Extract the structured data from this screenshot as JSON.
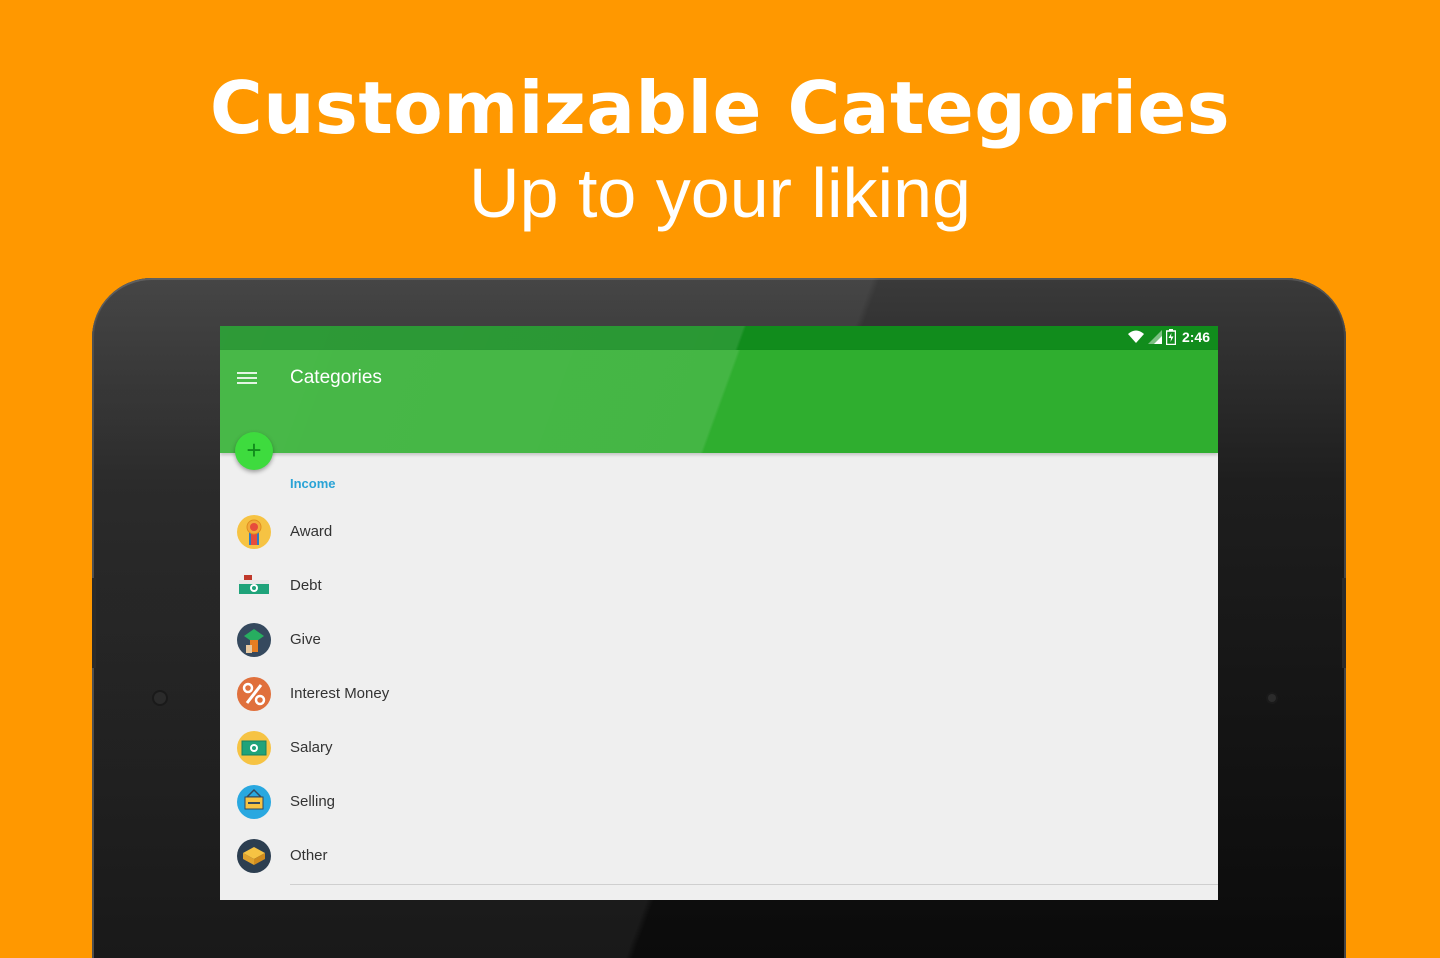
{
  "promo": {
    "headline": "Customizable Categories",
    "subline": "Up to your liking"
  },
  "colors": {
    "background": "#FF9800",
    "statusbar": "#118C1C",
    "appbar": "#2FAE2F",
    "fab": "#3EDB3E",
    "section_header": "#29A3D6"
  },
  "statusbar": {
    "time": "2:46",
    "icons": [
      "wifi-icon",
      "signal-icon",
      "battery-icon"
    ]
  },
  "appbar": {
    "title": "Categories",
    "menu_icon": "hamburger-menu-icon"
  },
  "fab": {
    "label": "+",
    "icon": "add-icon"
  },
  "section": {
    "header": "Income"
  },
  "categories": [
    {
      "label": "Award",
      "icon": "award-medal-icon"
    },
    {
      "label": "Debt",
      "icon": "money-drawer-icon"
    },
    {
      "label": "Give",
      "icon": "gift-give-icon"
    },
    {
      "label": "Interest Money",
      "icon": "percent-icon"
    },
    {
      "label": "Salary",
      "icon": "banknote-icon"
    },
    {
      "label": "Selling",
      "icon": "sale-tag-icon"
    },
    {
      "label": "Other",
      "icon": "stack-box-icon"
    }
  ]
}
